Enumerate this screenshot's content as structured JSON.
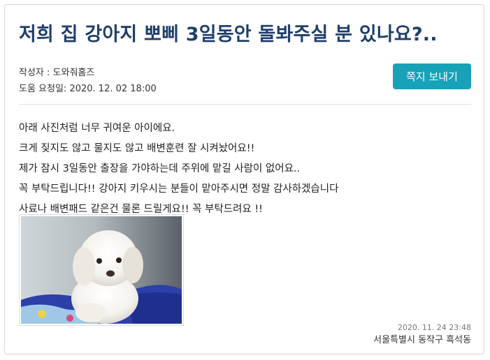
{
  "post": {
    "title": "저희 집 강아지 뽀삐 3일동안 돌봐주실 분 있나요?..",
    "author_line": "작성자 : 도와줘홈즈",
    "request_date_line": "도움 요청일: 2020. 12. 02 18:00",
    "message_button_label": "쪽지 보내기",
    "body_lines": [
      "아래 사진처럼 너무 귀여운 아이에요.",
      "크게 짖지도 않고 물지도 않고 배변훈련 잘 시켜놨어요!!",
      "제가 잠시 3일동안 출장을 가야하는데 주위에 맡길 사람이 없어요..",
      "꼭 부탁드립니다!! 강아지 키우시는 분들이 맡아주시면 정말 감사하겠습니다",
      "사료나 배변패드 같은건 물론 드릴게요!! 꼭 부탁드려요 !!"
    ],
    "posted_date": "2020. 11. 24 23:48",
    "location": "서울특별시 동작구 흑석동",
    "accent_color": "#17a2b8",
    "title_color": "#1f3f6b"
  }
}
